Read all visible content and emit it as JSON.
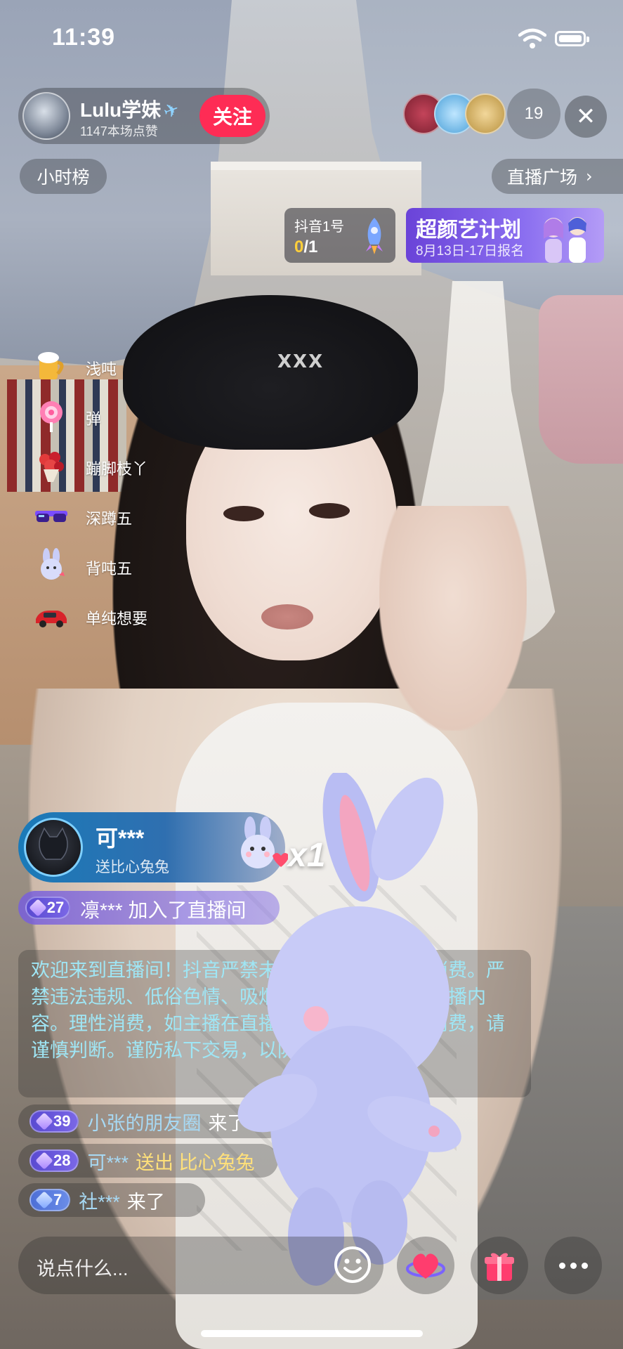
{
  "status_bar": {
    "time": "11:39"
  },
  "host": {
    "name": "Lulu学妹",
    "likes": "1147本场点赞",
    "follow_label": "关注"
  },
  "viewers": {
    "count": "19"
  },
  "top_pills": {
    "rank_label": "小时榜",
    "square_label": "直播广场"
  },
  "douyin_card": {
    "title": "抖音1号",
    "score_current": "0",
    "score_total": "/1"
  },
  "promo_card": {
    "title": "超颜艺计划",
    "subtitle": "8月13日-17日报名"
  },
  "gift_list": [
    {
      "icon": "beer-mug-icon",
      "name": "浅吨"
    },
    {
      "icon": "lollipop-icon",
      "name": "弹"
    },
    {
      "icon": "bouquet-icon",
      "name": "蹦脚枝丫"
    },
    {
      "icon": "sunglasses-icon",
      "name": "深蹲五"
    },
    {
      "icon": "bunny-icon",
      "name": "背吨五"
    },
    {
      "icon": "sports-car-icon",
      "name": "单纯想要"
    }
  ],
  "gift_banner": {
    "user": "可***",
    "action": "送比心兔兔",
    "count": "x1"
  },
  "join_message": {
    "level": "27",
    "text": "凛*** 加入了直播间"
  },
  "notice": {
    "text": "欢迎来到直播间！抖音严禁未成年人直播或礼物消费。严禁违法违规、低俗色情、吸烟酗酒、人身伤害等直播内容。理性消费，如主播在直播中以不当方式诱导消费，请谨慎判断。谨防私下交易，以防人身财产损失。"
  },
  "chat": [
    {
      "level": "39",
      "user": "小张的朋友圈",
      "msg": "来了",
      "gold": false
    },
    {
      "level": "28",
      "user": "可***",
      "msg": "送出 比心兔兔",
      "gold": true
    },
    {
      "level": "7",
      "user": "社***",
      "msg": "来了",
      "gold": false
    }
  ],
  "input": {
    "placeholder": "说点什么..."
  },
  "colors": {
    "follow": "#fe2c55",
    "notice_text": "#9fe6f5",
    "promo": "#6a43d8"
  }
}
